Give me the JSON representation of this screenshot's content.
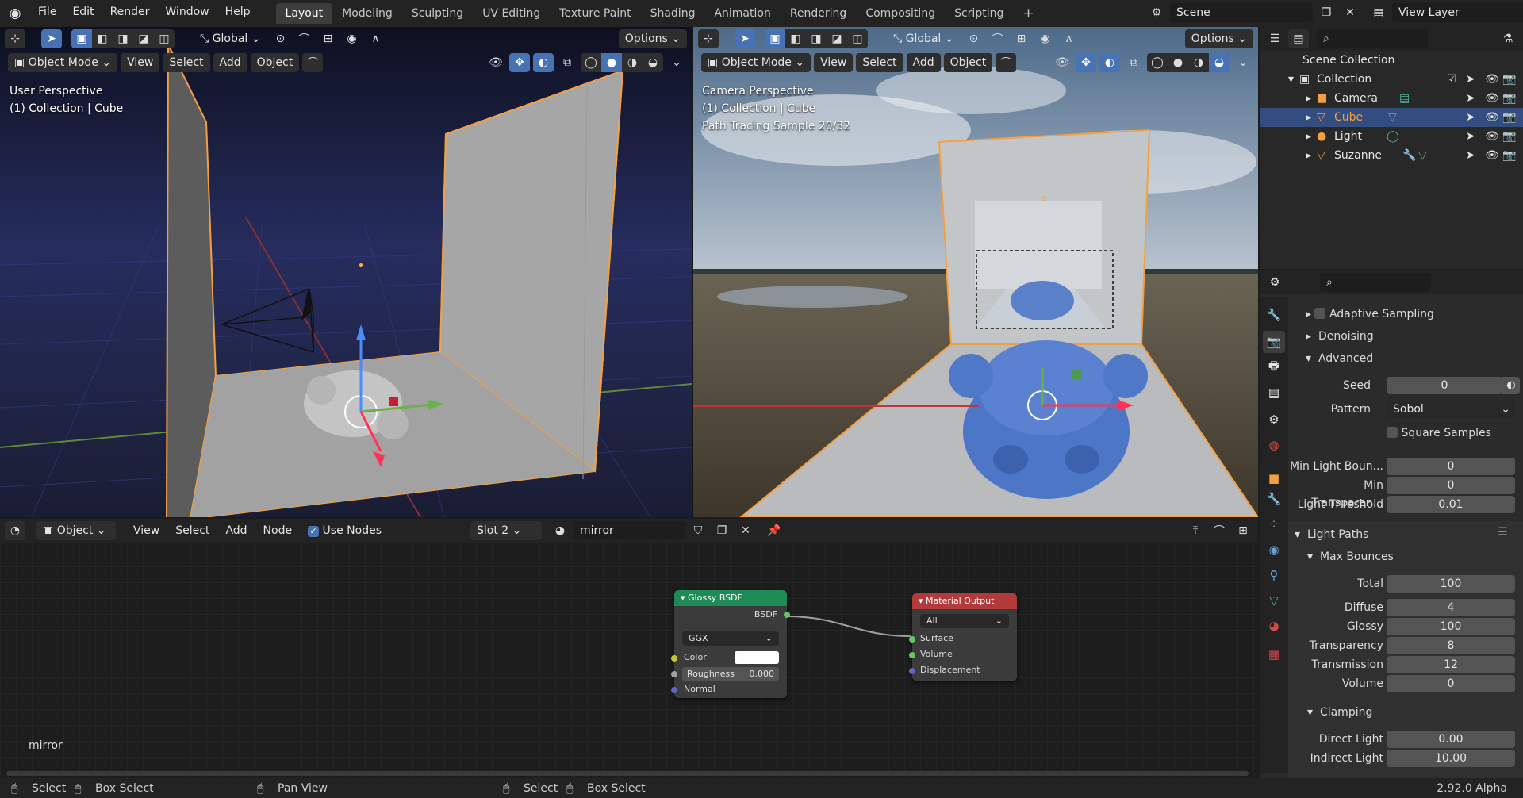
{
  "app": {
    "menu": [
      "File",
      "Edit",
      "Render",
      "Window",
      "Help"
    ],
    "workspaces": [
      "Layout",
      "Modeling",
      "Sculpting",
      "UV Editing",
      "Texture Paint",
      "Shading",
      "Animation",
      "Rendering",
      "Compositing",
      "Scripting"
    ],
    "active_workspace": "Layout",
    "scene": "Scene",
    "view_layer": "View Layer"
  },
  "viewport_left": {
    "orientation": "Global",
    "options": "Options",
    "mode": "Object Mode",
    "menus": [
      "View",
      "Select",
      "Add",
      "Object"
    ],
    "overlay_lines": [
      "User Perspective",
      "(1) Collection | Cube"
    ]
  },
  "viewport_right": {
    "orientation": "Global",
    "options": "Options",
    "mode": "Object Mode",
    "menus": [
      "View",
      "Select",
      "Add",
      "Object"
    ],
    "overlay_lines": [
      "Camera Perspective",
      "(1) Collection | Cube",
      "Path Tracing Sample 20/32"
    ]
  },
  "node_editor": {
    "type": "Object",
    "menus": [
      "View",
      "Select",
      "Add",
      "Node"
    ],
    "use_nodes": "Use Nodes",
    "slot": "Slot 2",
    "material": "mirror",
    "footer_label": "mirror",
    "glossy": {
      "title": "Glossy BSDF",
      "output": "BSDF",
      "distribution": "GGX",
      "color_label": "Color",
      "roughness_label": "Roughness",
      "roughness_value": "0.000",
      "normal_label": "Normal"
    },
    "output": {
      "title": "Material Output",
      "target": "All",
      "surface": "Surface",
      "volume": "Volume",
      "displacement": "Displacement"
    }
  },
  "outliner": {
    "root": "Scene Collection",
    "collection": "Collection",
    "items": [
      {
        "name": "Camera",
        "selected": false
      },
      {
        "name": "Cube",
        "selected": true
      },
      {
        "name": "Light",
        "selected": false
      },
      {
        "name": "Suzanne",
        "selected": false
      }
    ]
  },
  "properties": {
    "adaptive_sampling": "Adaptive Sampling",
    "denoising": "Denoising",
    "advanced": "Advanced",
    "seed_label": "Seed",
    "seed": "0",
    "pattern_label": "Pattern",
    "pattern": "Sobol",
    "square_samples": "Square Samples",
    "min_light_bounces_label": "Min Light Boun...",
    "min_light_bounces": "0",
    "min_transparent_label": "Min Transparen...",
    "min_transparent": "0",
    "light_threshold_label": "Light Threshold",
    "light_threshold": "0.01",
    "light_paths": "Light Paths",
    "max_bounces": "Max Bounces",
    "bounces": [
      {
        "label": "Total",
        "value": "100"
      },
      {
        "label": "Diffuse",
        "value": "4"
      },
      {
        "label": "Glossy",
        "value": "100"
      },
      {
        "label": "Transparency",
        "value": "8"
      },
      {
        "label": "Transmission",
        "value": "12"
      },
      {
        "label": "Volume",
        "value": "0"
      }
    ],
    "clamping": "Clamping",
    "direct_light_label": "Direct Light",
    "direct_light": "0.00",
    "indirect_light_label": "Indirect Light",
    "indirect_light": "10.00"
  },
  "status": {
    "select1": "Select",
    "box1": "Box Select",
    "pan": "Pan View",
    "select2": "Select",
    "box2": "Box Select",
    "version": "2.92.0 Alpha"
  },
  "colors": {
    "accent": "#4772b3",
    "selection": "#334d80",
    "orange_outline": "#f5a040",
    "glossy_header": "#1e8a55",
    "output_header": "#b33a3a"
  }
}
